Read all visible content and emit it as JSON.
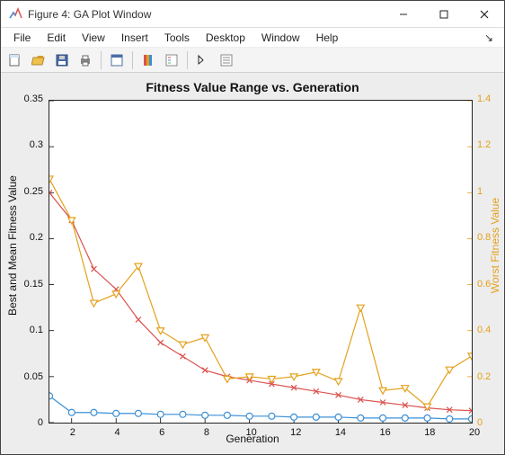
{
  "window": {
    "title": "Figure 4: GA Plot Window"
  },
  "menu": {
    "items": [
      "File",
      "Edit",
      "View",
      "Insert",
      "Tools",
      "Desktop",
      "Window",
      "Help"
    ]
  },
  "toolbar_icons": [
    "new-figure",
    "open",
    "save",
    "print",
    "data-cursor",
    "link",
    "colorbar",
    "legend",
    "cursor",
    "insert-legend"
  ],
  "chart_data": {
    "type": "line",
    "title": "Fitness Value Range vs. Generation",
    "xlabel": "Generation",
    "ylabel_left": "Best and Mean Fitness Value",
    "ylabel_right": "Worst Fitness Value",
    "x": [
      1,
      2,
      3,
      4,
      5,
      6,
      7,
      8,
      9,
      10,
      11,
      12,
      13,
      14,
      15,
      16,
      17,
      18,
      19,
      20
    ],
    "xlim": [
      1,
      20
    ],
    "xticks": [
      2,
      4,
      6,
      8,
      10,
      12,
      14,
      16,
      18,
      20
    ],
    "ylim_left": [
      0,
      0.35
    ],
    "yticks_left": [
      0,
      0.05,
      0.1,
      0.15,
      0.2,
      0.25,
      0.3,
      0.35
    ],
    "ylim_right": [
      0,
      1.4
    ],
    "yticks_right": [
      0,
      0.2,
      0.4,
      0.6,
      0.8,
      1,
      1.2,
      1.4
    ],
    "series": [
      {
        "name": "Best",
        "axis": "left",
        "color": "#3b8fd6",
        "marker": "o",
        "values": [
          0.029,
          0.011,
          0.011,
          0.01,
          0.01,
          0.009,
          0.009,
          0.008,
          0.008,
          0.007,
          0.007,
          0.006,
          0.006,
          0.006,
          0.005,
          0.005,
          0.005,
          0.005,
          0.004,
          0.004
        ]
      },
      {
        "name": "Mean",
        "axis": "left",
        "color": "#d9534f",
        "marker": "x",
        "values": [
          0.25,
          0.22,
          0.167,
          0.145,
          0.112,
          0.087,
          0.072,
          0.057,
          0.05,
          0.046,
          0.042,
          0.038,
          0.034,
          0.03,
          0.025,
          0.022,
          0.019,
          0.016,
          0.014,
          0.013
        ]
      },
      {
        "name": "Worst",
        "axis": "right",
        "color": "#e4a11b",
        "marker": "v",
        "values": [
          1.06,
          0.88,
          0.52,
          0.56,
          0.68,
          0.4,
          0.34,
          0.37,
          0.19,
          0.2,
          0.19,
          0.2,
          0.22,
          0.18,
          0.5,
          0.14,
          0.15,
          0.07,
          0.23,
          0.29
        ]
      }
    ]
  }
}
